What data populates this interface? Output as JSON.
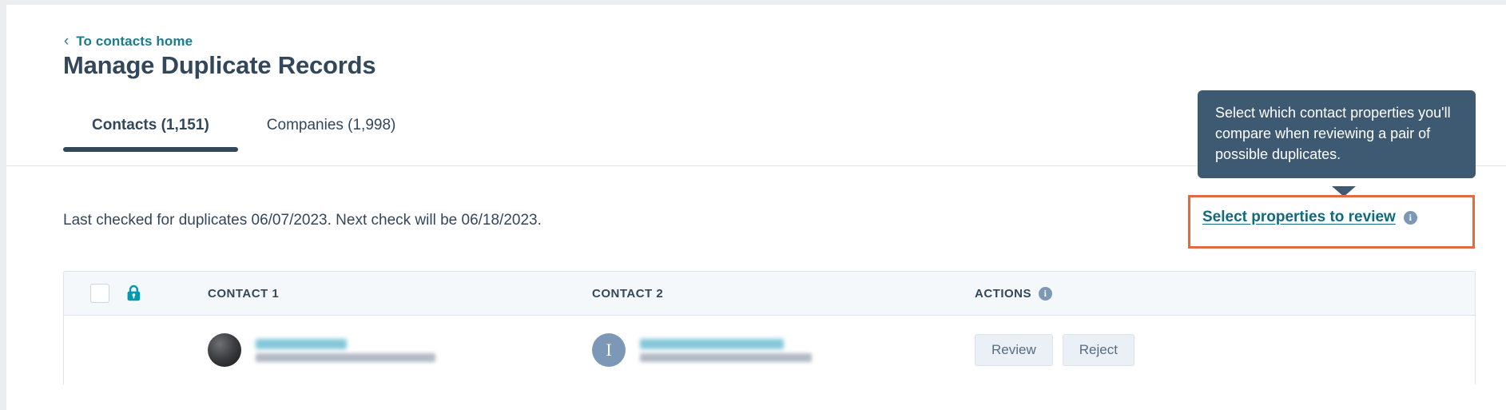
{
  "breadcrumb": {
    "chevron": "chevron-left-icon",
    "label": "To contacts home"
  },
  "header": {
    "title": "Manage Duplicate Records"
  },
  "tabs": [
    {
      "label": "Contacts (1,151)",
      "active": true
    },
    {
      "label": "Companies (1,998)",
      "active": false
    }
  ],
  "status": {
    "text": "Last checked for duplicates 06/07/2023. Next check will be 06/18/2023.",
    "last_checked_date": "06/07/2023",
    "next_check_date": "06/18/2023"
  },
  "tooltip": {
    "text": "Select which contact properties you'll compare when reviewing a pair of possible duplicates.",
    "background": "#3d5a72"
  },
  "select_properties": {
    "label": "Select properties to review",
    "info_icon": "info-icon",
    "link_color": "#0f6a7e",
    "highlight_color": "#dd6b43"
  },
  "table": {
    "select_all_checkbox": "checkbox",
    "lock_icon": "lock-icon",
    "lock_color": "#009aae",
    "columns": [
      {
        "label": "CONTACT 1"
      },
      {
        "label": "CONTACT 2"
      },
      {
        "label": "ACTIONS",
        "info_icon": "info-icon"
      }
    ],
    "rows": [
      {
        "contact1": {
          "avatar_type": "photo",
          "avatar_initial": "",
          "name": "[redacted]",
          "email": "[redacted]"
        },
        "contact2": {
          "avatar_type": "initial",
          "avatar_initial": "I",
          "name": "[redacted]",
          "email": "[redacted]"
        },
        "actions": {
          "review_label": "Review",
          "reject_label": "Reject"
        }
      }
    ]
  }
}
